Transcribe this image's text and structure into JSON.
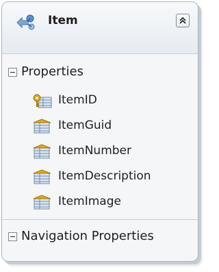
{
  "entity": {
    "title": "Item",
    "icon": "entity-type-icon",
    "collapse_icon": "double-chevron-up-icon"
  },
  "sections": {
    "properties": {
      "label": "Properties",
      "toggle_icon": "minus-box-icon",
      "items": [
        {
          "name": "ItemID",
          "icon": "key-property-icon"
        },
        {
          "name": "ItemGuid",
          "icon": "scalar-property-icon"
        },
        {
          "name": "ItemNumber",
          "icon": "scalar-property-icon"
        },
        {
          "name": "ItemDescription",
          "icon": "scalar-property-icon"
        },
        {
          "name": "ItemImage",
          "icon": "scalar-property-icon"
        }
      ]
    },
    "navigation": {
      "label": "Navigation Properties",
      "toggle_icon": "minus-box-icon"
    }
  },
  "colors": {
    "header_gradient_top": "#f7f9fb",
    "header_gradient_bottom": "#e6ebf1",
    "border": "#a9b4bf",
    "key_gold": "#e0a81e"
  }
}
